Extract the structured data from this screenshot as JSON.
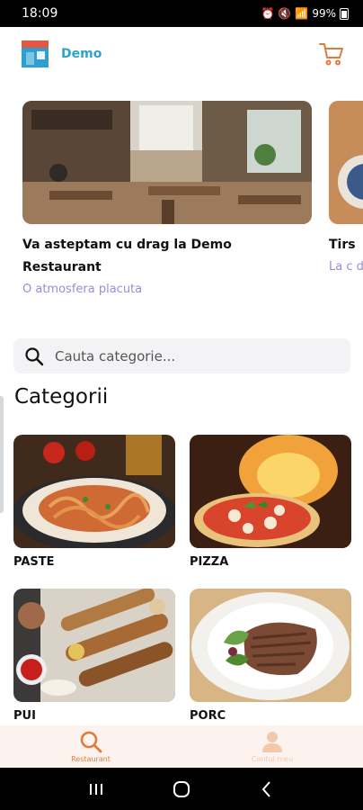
{
  "status_bar": {
    "time": "18:09",
    "battery": "99%"
  },
  "app": {
    "brand": "Demo"
  },
  "carousel": [
    {
      "title": "Va asteptam cu drag la Demo Restaurant",
      "subtitle": "O atmosfera placuta"
    },
    {
      "title": "Tirs",
      "subtitle": "La c de I"
    }
  ],
  "search": {
    "placeholder": "Cauta categorie..."
  },
  "categories_title": "Categorii",
  "categories": [
    {
      "label": "PASTE"
    },
    {
      "label": "PIZZA"
    },
    {
      "label": "PUI"
    },
    {
      "label": "PORC"
    }
  ],
  "tabs": [
    {
      "label": "Restaurant",
      "active": true
    },
    {
      "label": "Contul meu",
      "active": false
    }
  ],
  "colors": {
    "accent": "#e07b3e",
    "brand": "#2ea3cf",
    "subtitle": "#9b8bd6",
    "tabbar": "#fdf3ee"
  }
}
